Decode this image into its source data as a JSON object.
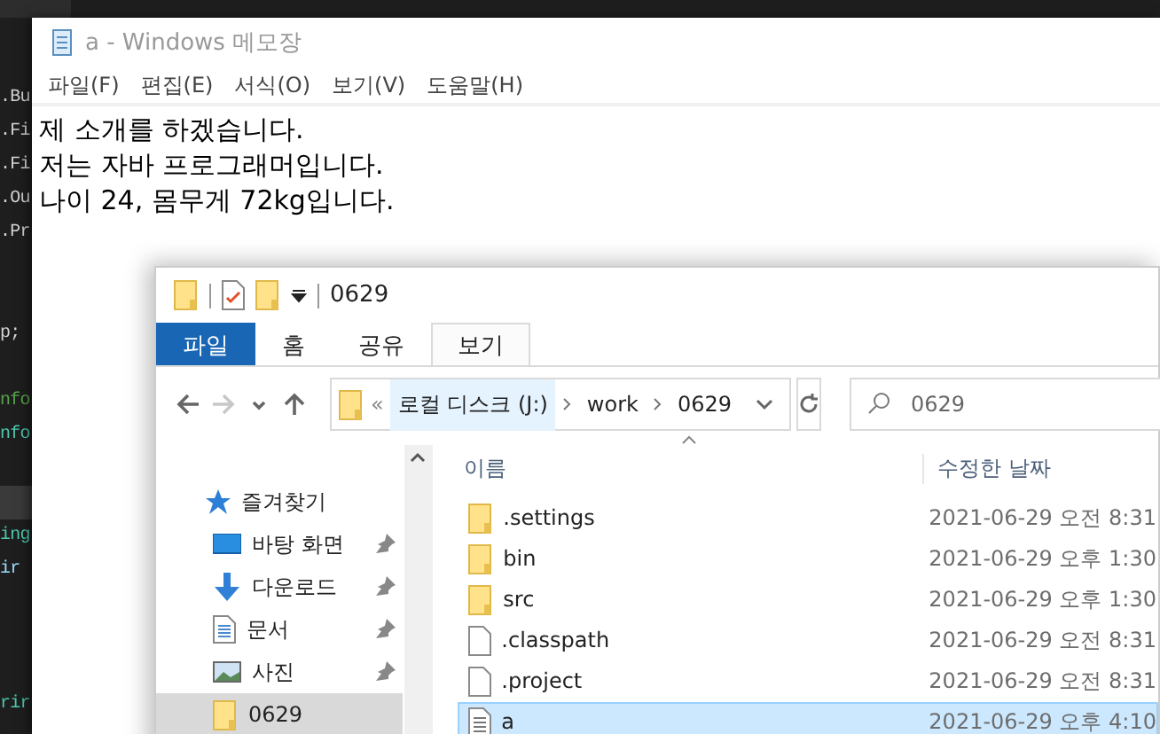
{
  "editor": {
    "lines": [
      {
        "kind": "code",
        "text": ".Bu",
        "color": "#d4d4d4",
        "current": false
      },
      {
        "kind": "code",
        "text": ".Fi",
        "color": "#d4d4d4",
        "current": false
      },
      {
        "kind": "code",
        "text": ".Fi",
        "color": "#d4d4d4",
        "current": false
      },
      {
        "kind": "code",
        "text": ".Ou",
        "color": "#d4d4d4",
        "current": false
      },
      {
        "kind": "code",
        "text": ".Pr",
        "color": "#d4d4d4",
        "current": false
      },
      {
        "kind": "blank",
        "current": false
      },
      {
        "kind": "blank",
        "current": false
      },
      {
        "kind": "code",
        "text": "p;",
        "color": "#d4d4d4",
        "current": false
      },
      {
        "kind": "blank",
        "current": false
      },
      {
        "kind": "code",
        "text": "nfo",
        "color": "#57a64a",
        "current": false
      },
      {
        "kind": "code",
        "text": "nfo",
        "color": "#4ec9b0",
        "current": false
      },
      {
        "kind": "blank",
        "current": false
      },
      {
        "kind": "blank",
        "current": true
      },
      {
        "kind": "code",
        "text": "ing",
        "color": "#4ec9b0",
        "current": false
      },
      {
        "kind": "code",
        "text": "ir",
        "color": "#9cdcfe",
        "current": false
      },
      {
        "kind": "blank",
        "current": false
      },
      {
        "kind": "blank",
        "current": false
      },
      {
        "kind": "blank",
        "current": false
      },
      {
        "kind": "code",
        "text": "rir",
        "color": "#4ec9b0",
        "current": false
      }
    ]
  },
  "notepad": {
    "title": "a - Windows 메모장",
    "menu": [
      "파일(F)",
      "편집(E)",
      "서식(O)",
      "보기(V)",
      "도움말(H)"
    ],
    "text_lines": [
      "제 소개를 하겠습니다.",
      "저는 자바 프로그래머입니다.",
      "나이 24, 몸무게 72kg입니다."
    ]
  },
  "explorer": {
    "title": "0629",
    "tabs": [
      {
        "label": "파일",
        "kind": "file",
        "selected": false
      },
      {
        "label": "홈",
        "kind": "tab",
        "selected": false
      },
      {
        "label": "공유",
        "kind": "tab",
        "selected": false
      },
      {
        "label": "보기",
        "kind": "tab",
        "selected": true
      }
    ],
    "nav_buttons": [
      {
        "kind": "back",
        "disabled": false
      },
      {
        "kind": "forward",
        "disabled": true
      },
      {
        "kind": "recent",
        "disabled": false
      },
      {
        "kind": "up",
        "disabled": false
      }
    ],
    "address": {
      "overflow": "«",
      "segments": [
        {
          "label": "로컬 디스크 (J:)",
          "selected": true
        },
        {
          "label": "work",
          "selected": false
        },
        {
          "label": "0629",
          "selected": false
        }
      ]
    },
    "search": {
      "placeholder": "0629"
    },
    "sidebar": {
      "items": [
        {
          "label": "즐겨찾기",
          "kind": "star",
          "pinned": false,
          "selected": false
        },
        {
          "label": "바탕 화면",
          "kind": "desktop",
          "pinned": true,
          "selected": false
        },
        {
          "label": "다운로드",
          "kind": "download",
          "pinned": true,
          "selected": false
        },
        {
          "label": "문서",
          "kind": "document",
          "pinned": true,
          "selected": false
        },
        {
          "label": "사진",
          "kind": "pictures",
          "pinned": true,
          "selected": false
        },
        {
          "label": "0629",
          "kind": "folder",
          "pinned": false,
          "selected": true
        }
      ]
    },
    "table": {
      "columns": [
        "이름",
        "수정한 날짜"
      ],
      "rows": [
        {
          "name": ".settings",
          "kind": "folder",
          "date": "2021-06-29 오전 8:31",
          "selected": false
        },
        {
          "name": "bin",
          "kind": "folder",
          "date": "2021-06-29 오후 1:30",
          "selected": false
        },
        {
          "name": "src",
          "kind": "folder",
          "date": "2021-06-29 오후 1:30",
          "selected": false
        },
        {
          "name": ".classpath",
          "kind": "file",
          "date": "2021-06-29 오전 8:31",
          "selected": false
        },
        {
          "name": ".project",
          "kind": "file",
          "date": "2021-06-29 오전 8:31",
          "selected": false
        },
        {
          "name": "a",
          "kind": "text",
          "date": "2021-06-29 오후 4:10",
          "selected": true
        }
      ]
    }
  }
}
